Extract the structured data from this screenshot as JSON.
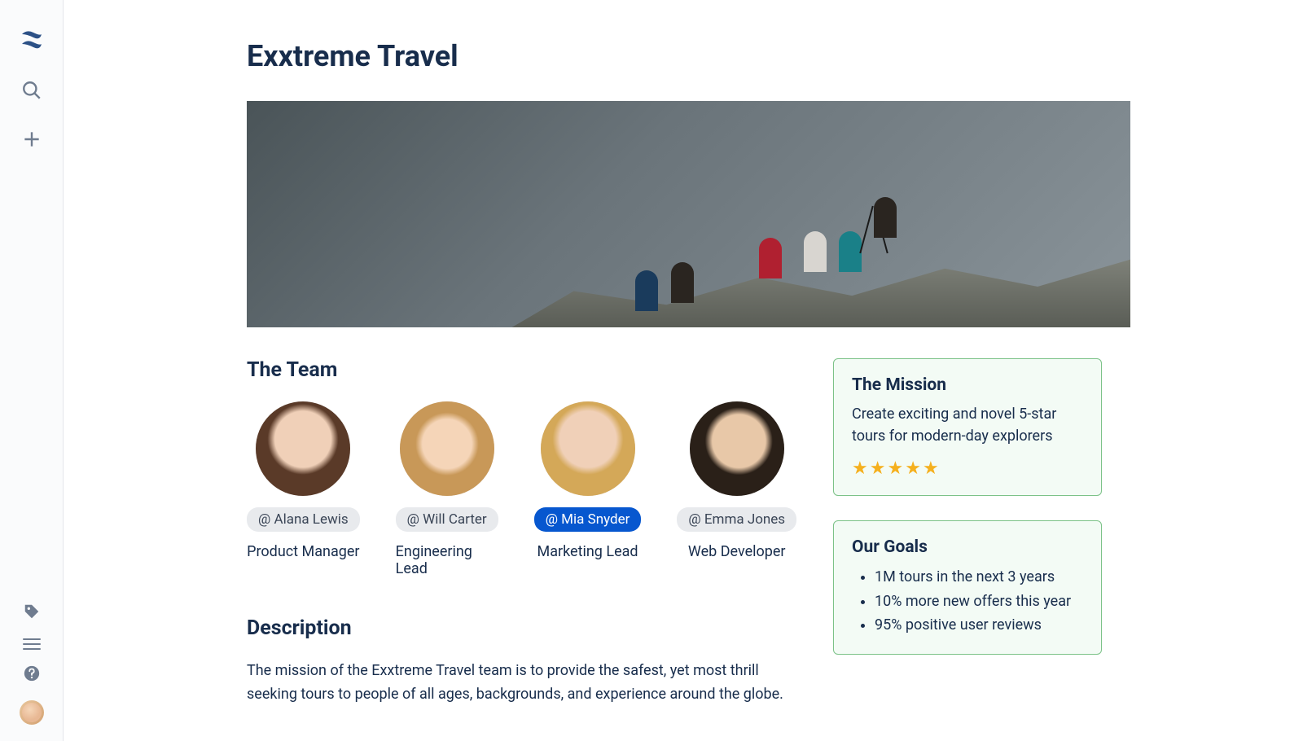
{
  "page": {
    "title": "Exxtreme Travel"
  },
  "team": {
    "heading": "The Team",
    "members": [
      {
        "mention": "@ Alana Lewis",
        "role": "Product Manager",
        "active": false
      },
      {
        "mention": "@ Will Carter",
        "role": "Engineering Lead",
        "active": false
      },
      {
        "mention": "@ Mia Snyder",
        "role": "Marketing Lead",
        "active": true
      },
      {
        "mention": "@ Emma Jones",
        "role": "Web Developer",
        "active": false
      }
    ]
  },
  "description": {
    "heading": "Description",
    "text": "The mission of the Exxtreme Travel team is to provide the safest, yet most thrill seeking tours to people of all ages, backgrounds, and experience around the globe."
  },
  "mission": {
    "heading": "The Mission",
    "text": "Create exciting and novel 5-star tours for modern-day explorers",
    "rating": 5
  },
  "goals": {
    "heading": "Our Goals",
    "items": [
      "1M tours in the next 3 years",
      "10% more new offers this year",
      "95% positive user reviews"
    ]
  }
}
